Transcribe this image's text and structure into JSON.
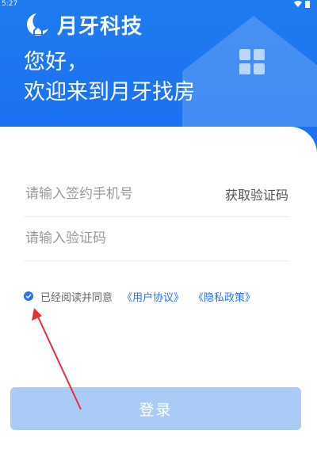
{
  "status_bar": {
    "time": "5:27"
  },
  "header": {
    "logo_text": "月牙科技",
    "greeting_line1": "您好，",
    "greeting_line2": "欢迎来到月牙找房"
  },
  "form": {
    "phone_placeholder": "请输入签约手机号",
    "get_code_label": "获取验证码",
    "code_placeholder": "请输入验证码"
  },
  "agreement": {
    "prefix": "已经阅读并同意",
    "user_agreement": "《用户协议》",
    "privacy_policy": "《隐私政策》"
  },
  "login_button": {
    "label": "登录"
  },
  "colors": {
    "header_blue": "#1f7bf0",
    "link_blue": "#2a73e8",
    "button_disabled": "#a9cbf6",
    "annotation_arrow": "#e0303a"
  }
}
